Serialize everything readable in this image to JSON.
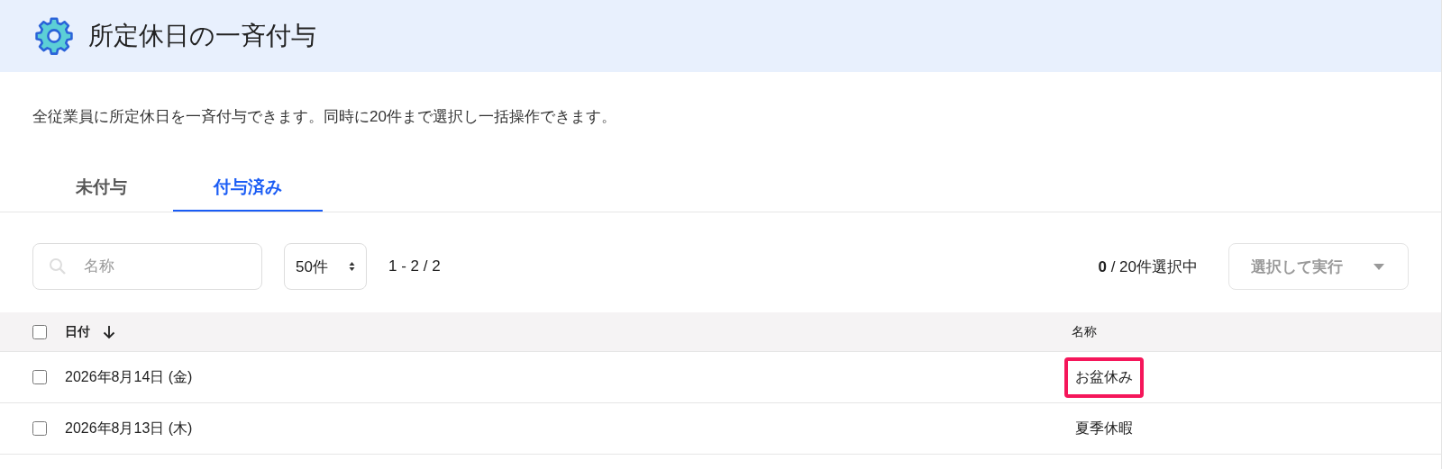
{
  "header": {
    "title": "所定休日の一斉付与"
  },
  "description": "全従業員に所定休日を一斉付与できます。同時に20件まで選択し一括操作できます。",
  "tabs": [
    {
      "label": "未付与",
      "selected": false
    },
    {
      "label": "付与済み",
      "selected": true
    }
  ],
  "toolbar": {
    "search": {
      "placeholder": "名称"
    },
    "page_size": "50件",
    "pagination": "1 - 2 / 2",
    "selection_count": "**0** / 20件選択中",
    "action_button": {
      "label": "選択して実行",
      "disabled": true
    }
  },
  "table": {
    "select_all": {
      "checked": false
    },
    "columns": [
      {
        "label": "日付",
        "sorted": true
      },
      {
        "label": "名称",
        "sorted": false
      }
    ],
    "rows": [
      {
        "checked": false,
        "date": "2026年8月14日 (金)",
        "name": "お盆休み",
        "highlighted": true
      },
      {
        "checked": false,
        "date": "2026年8月13日 (木)",
        "name": "夏季休暇",
        "highlighted": false
      }
    ]
  }
}
